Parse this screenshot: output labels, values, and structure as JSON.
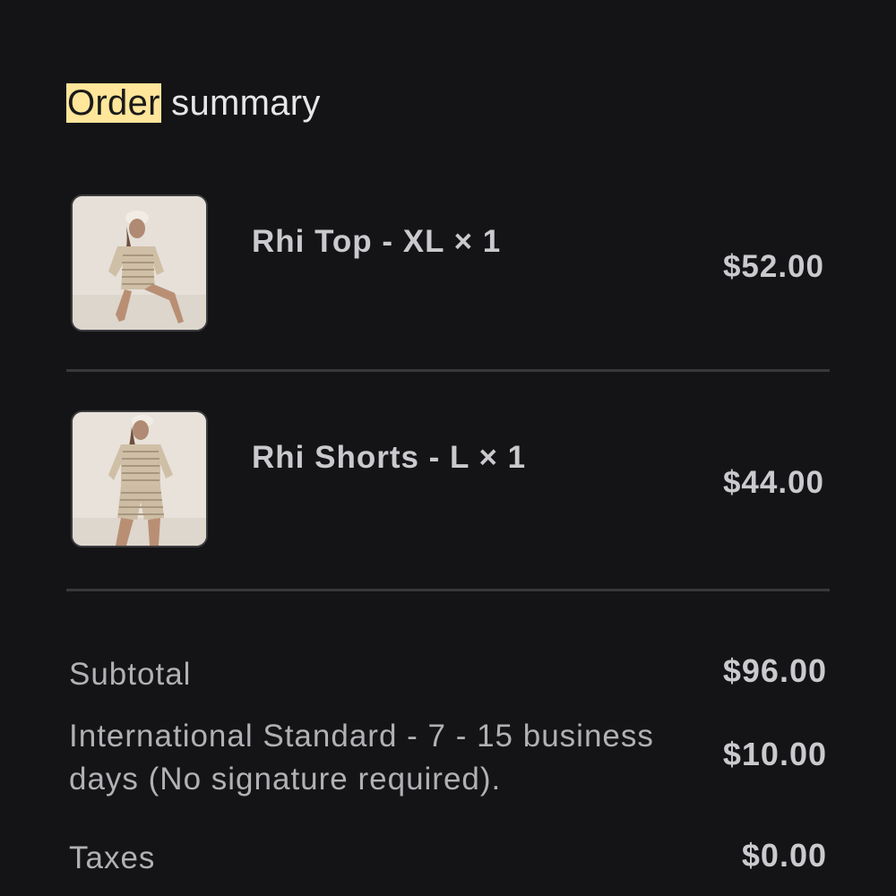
{
  "header": {
    "title_highlight": "Order",
    "title_rest": " summary"
  },
  "items": [
    {
      "name": "Rhi Top - XL × 1",
      "price": "$52.00"
    },
    {
      "name": "Rhi Shorts - L × 1",
      "price": "$44.00"
    }
  ],
  "summary": {
    "subtotal_label": "Subtotal",
    "subtotal_value": "$96.00",
    "shipping_label": "International Standard - 7 - 15 business days (No signature required).",
    "shipping_value": "$10.00",
    "taxes_label": "Taxes",
    "taxes_value": "$0.00"
  },
  "colors": {
    "background": "#141416",
    "highlight": "#ffe69a",
    "divider": "#38383b"
  }
}
